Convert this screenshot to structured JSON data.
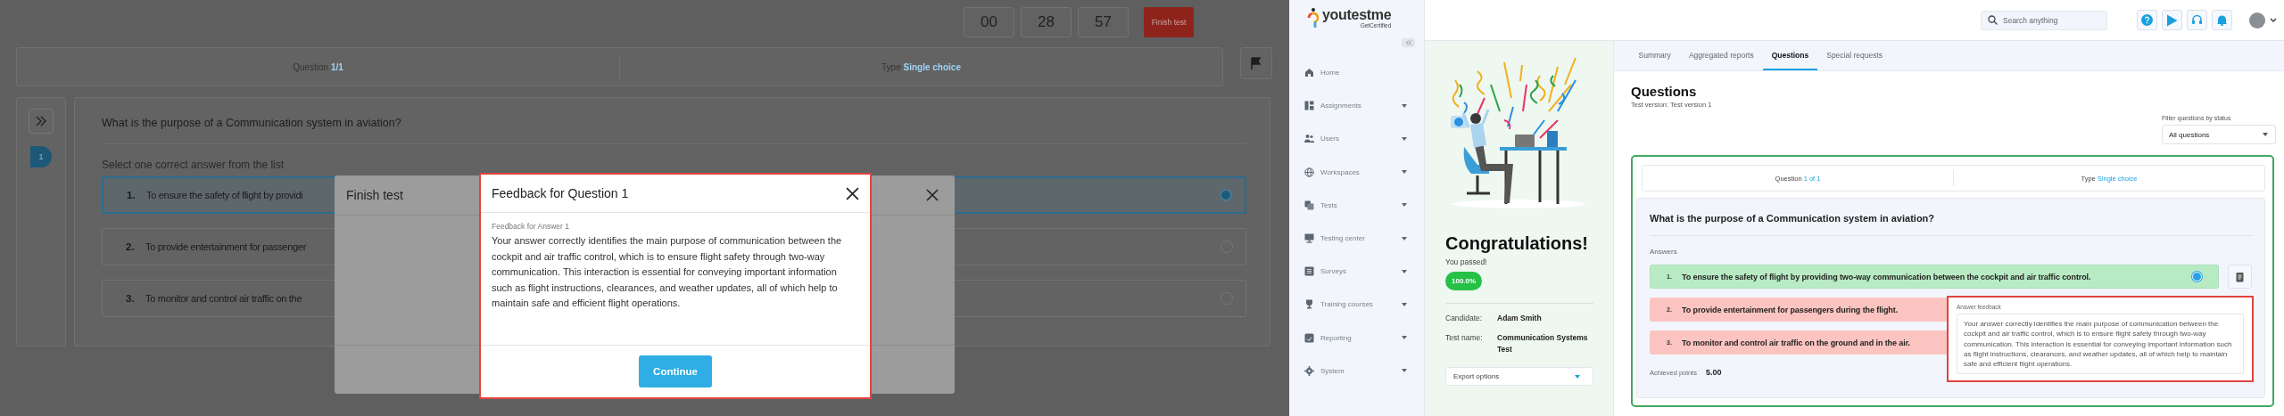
{
  "left_screen": {
    "timer": [
      "00",
      "28",
      "57"
    ],
    "finish_button": "Finish test",
    "question_bar": {
      "label": "Question",
      "value": "1/1",
      "type_label": "Type",
      "type_value": "Single choice"
    },
    "question_nav": [
      {
        "label": "1",
        "selected": true
      }
    ],
    "question": "What is the purpose of a Communication system in aviation?",
    "instruction": "Select one correct answer from the list",
    "answers": [
      {
        "number": "1.",
        "text": "To ensure the safety of flight by providi",
        "selected": true
      },
      {
        "number": "2.",
        "text": "To provide entertainment for passenger",
        "selected": false
      },
      {
        "number": "3.",
        "text": "To monitor and control air traffic on the",
        "selected": false
      }
    ],
    "finish_dialog": {
      "title": "Finish test"
    },
    "feedback_modal": {
      "title": "Feedback for Question 1",
      "subtitle": "Feedback for Answer 1",
      "text": "Your answer correctly identifies the main purpose of communication between the cockpit and air traffic control, which is to ensure flight safety through two-way communication. This interaction is essential for conveying important information such as flight instructions, clearances, and weather updates, all of which help to maintain safe and efficient flight operations.",
      "button": "Continue"
    }
  },
  "right_screen": {
    "logo": {
      "name": "youtestme",
      "tagline": "GetCertified"
    },
    "sidebar": [
      {
        "label": "Home",
        "expandable": false
      },
      {
        "label": "Assignments",
        "expandable": true
      },
      {
        "label": "Users",
        "expandable": true
      },
      {
        "label": "Workspaces",
        "expandable": true
      },
      {
        "label": "Tests",
        "expandable": true
      },
      {
        "label": "Testing center",
        "expandable": true
      },
      {
        "label": "Surveys",
        "expandable": true
      },
      {
        "label": "Training courses",
        "expandable": true
      },
      {
        "label": "Reporting",
        "expandable": true
      },
      {
        "label": "System",
        "expandable": true
      }
    ],
    "search": {
      "placeholder": "Search anything"
    },
    "result": {
      "title": "Congratulations!",
      "subtitle": "You passed!",
      "score": "100.0%",
      "details": [
        {
          "label": "Candidate:",
          "value": "Adam Smith"
        },
        {
          "label": "Test name:",
          "value": "Communication Systems Test"
        }
      ],
      "export": "Export options"
    },
    "tabs": [
      {
        "label": "Summary",
        "selected": false
      },
      {
        "label": "Aggregated reports",
        "selected": false
      },
      {
        "label": "Questions",
        "selected": true
      },
      {
        "label": "Special requests",
        "selected": false
      }
    ],
    "questions": {
      "title": "Questions",
      "version": "Test version: Test version 1",
      "filter_label": "Filter questions by status",
      "filter_value": "All questions",
      "question_label": "Question",
      "question_value": "1 of 1",
      "type_label": "Type",
      "type_value": "Single choice",
      "question": "What is the purpose of a Communication system in aviation?",
      "answers_label": "Answers",
      "answers": [
        {
          "number": "1.",
          "text": "To ensure the safety of flight by providing two-way communication between the cockpit and air traffic control.",
          "correct": true,
          "selected": true
        },
        {
          "number": "2.",
          "text": "To provide entertainment for passengers during the flight.",
          "correct": false,
          "selected": false
        },
        {
          "number": "3.",
          "text": "To monitor and control air traffic on the ground and in the air.",
          "correct": false,
          "selected": false
        }
      ],
      "points_label": "Achieved points",
      "points": "5.00",
      "feedback": {
        "label": "Answer feedback",
        "text": "Your answer correctly identifies the main purpose of communication between the cockpit and air traffic control, which is to ensure flight safety through two-way communication. This interaction is essential for conveying important information such as flight instructions, clearances, and weather updates, all of which help to maintain safe and efficient flight operations."
      }
    }
  }
}
